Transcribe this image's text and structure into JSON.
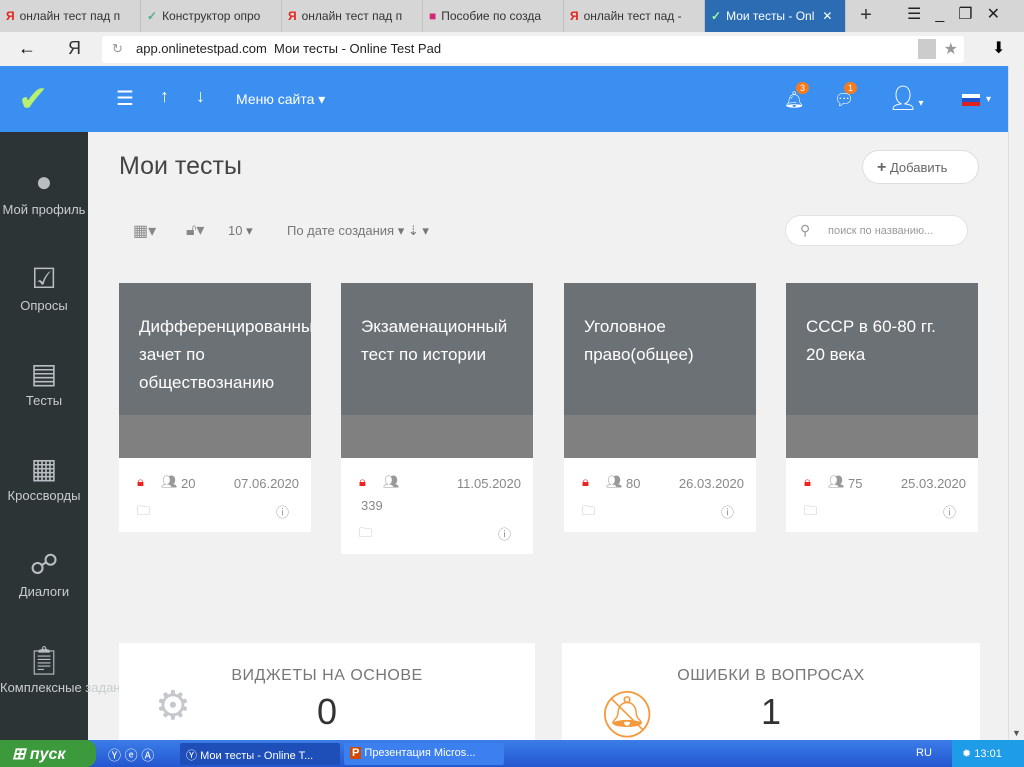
{
  "browser": {
    "tabs": [
      {
        "label": "онлайн тест пад п",
        "icon": "yandex-icon"
      },
      {
        "label": "Конструктор опро",
        "icon": "onlinetestpad-icon"
      },
      {
        "label": "онлайн тест пад п",
        "icon": "yandex-icon"
      },
      {
        "label": "Пособие по созда",
        "icon": "presentation-icon"
      },
      {
        "label": "онлайн тест пад -",
        "icon": "yandex-icon"
      },
      {
        "label": "Мои тесты - Onl",
        "icon": "onlinetestpad-icon",
        "active": true
      }
    ],
    "domain": "app.onlinetestpad.com",
    "page_title": "Мои тесты - Online Test Pad"
  },
  "header": {
    "menu_label": "Меню сайта",
    "notifications": "3",
    "messages": "1",
    "accent": "#3a8ff0"
  },
  "sidebar": {
    "items": [
      {
        "label": "Мой профиль"
      },
      {
        "label": "Опросы"
      },
      {
        "label": "Тесты"
      },
      {
        "label": "Кроссворды"
      },
      {
        "label": "Диалоги"
      },
      {
        "label": "Комплексные задания"
      }
    ]
  },
  "main": {
    "title": "Мои тесты",
    "add_label": "Добавить",
    "page_size": "10",
    "sort_label": "По дате создания",
    "search_placeholder": "поиск по названию...",
    "cards": [
      {
        "title_lines": [
          "Дифференцированный",
          "зачет по",
          "обществознанию"
        ],
        "count": "20",
        "date": "07.06.2020"
      },
      {
        "title_lines": [
          "Экзаменационный",
          "тест по истории"
        ],
        "count": "339",
        "date": "11.05.2020"
      },
      {
        "title_lines": [
          "Уголовное",
          "право(общее)"
        ],
        "count": "80",
        "date": "26.03.2020"
      },
      {
        "title_lines": [
          "СССР в 60-80 гг.",
          "20 века"
        ],
        "count": "75",
        "date": "25.03.2020"
      }
    ],
    "widgets": [
      {
        "title": "ВИДЖЕТЫ НА ОСНОВЕ",
        "value": "0"
      },
      {
        "title": "ОШИБКИ В ВОПРОСАХ",
        "value": "1"
      }
    ]
  },
  "taskbar": {
    "start": "пуск",
    "items": [
      "Мои тесты - Online T...",
      "Презентация Micros..."
    ],
    "lang": "RU",
    "time": "13:01"
  }
}
